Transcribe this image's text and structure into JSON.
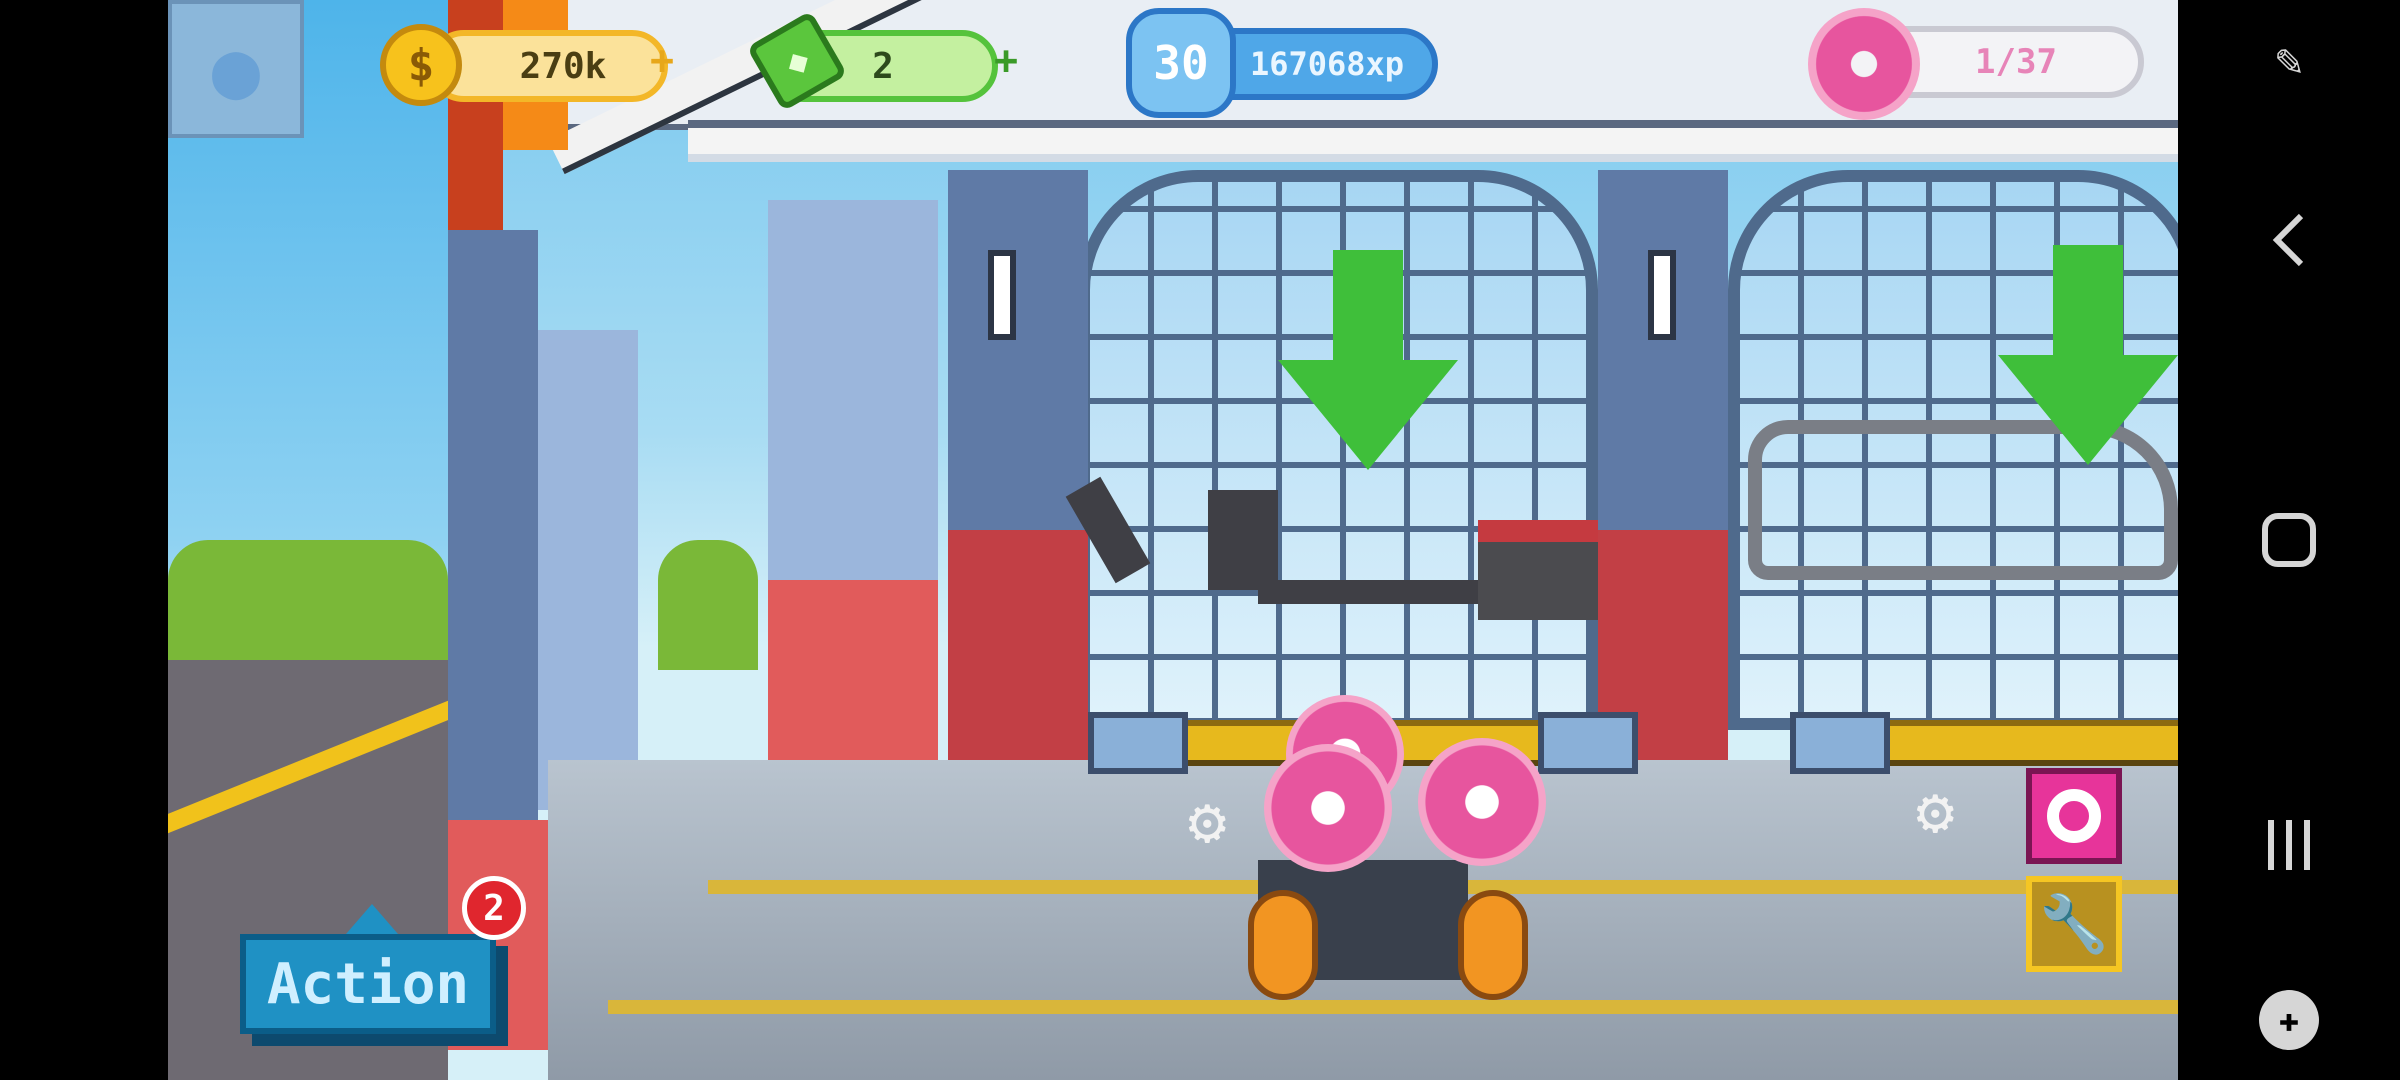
{
  "hud": {
    "coins": {
      "value": "270k",
      "icon": "dollar-coin-icon"
    },
    "cash": {
      "value": "2",
      "icon": "cash-icon"
    },
    "xp": {
      "level": "30",
      "value": "167068xp",
      "icon": "level-star-icon"
    },
    "donuts": {
      "value": "1/37",
      "icon": "donut-icon"
    }
  },
  "action": {
    "label": "Action",
    "badge": "2"
  },
  "tools": {
    "donut_tool_icon": "donut-ring-icon",
    "wrench_icon": "wrench-icon"
  },
  "colors": {
    "coin": "#f3b728",
    "cash": "#55c33c",
    "xp": "#2c77c7",
    "donut": "#e7559e",
    "action": "#1f91c4",
    "badge": "#e0262e"
  }
}
